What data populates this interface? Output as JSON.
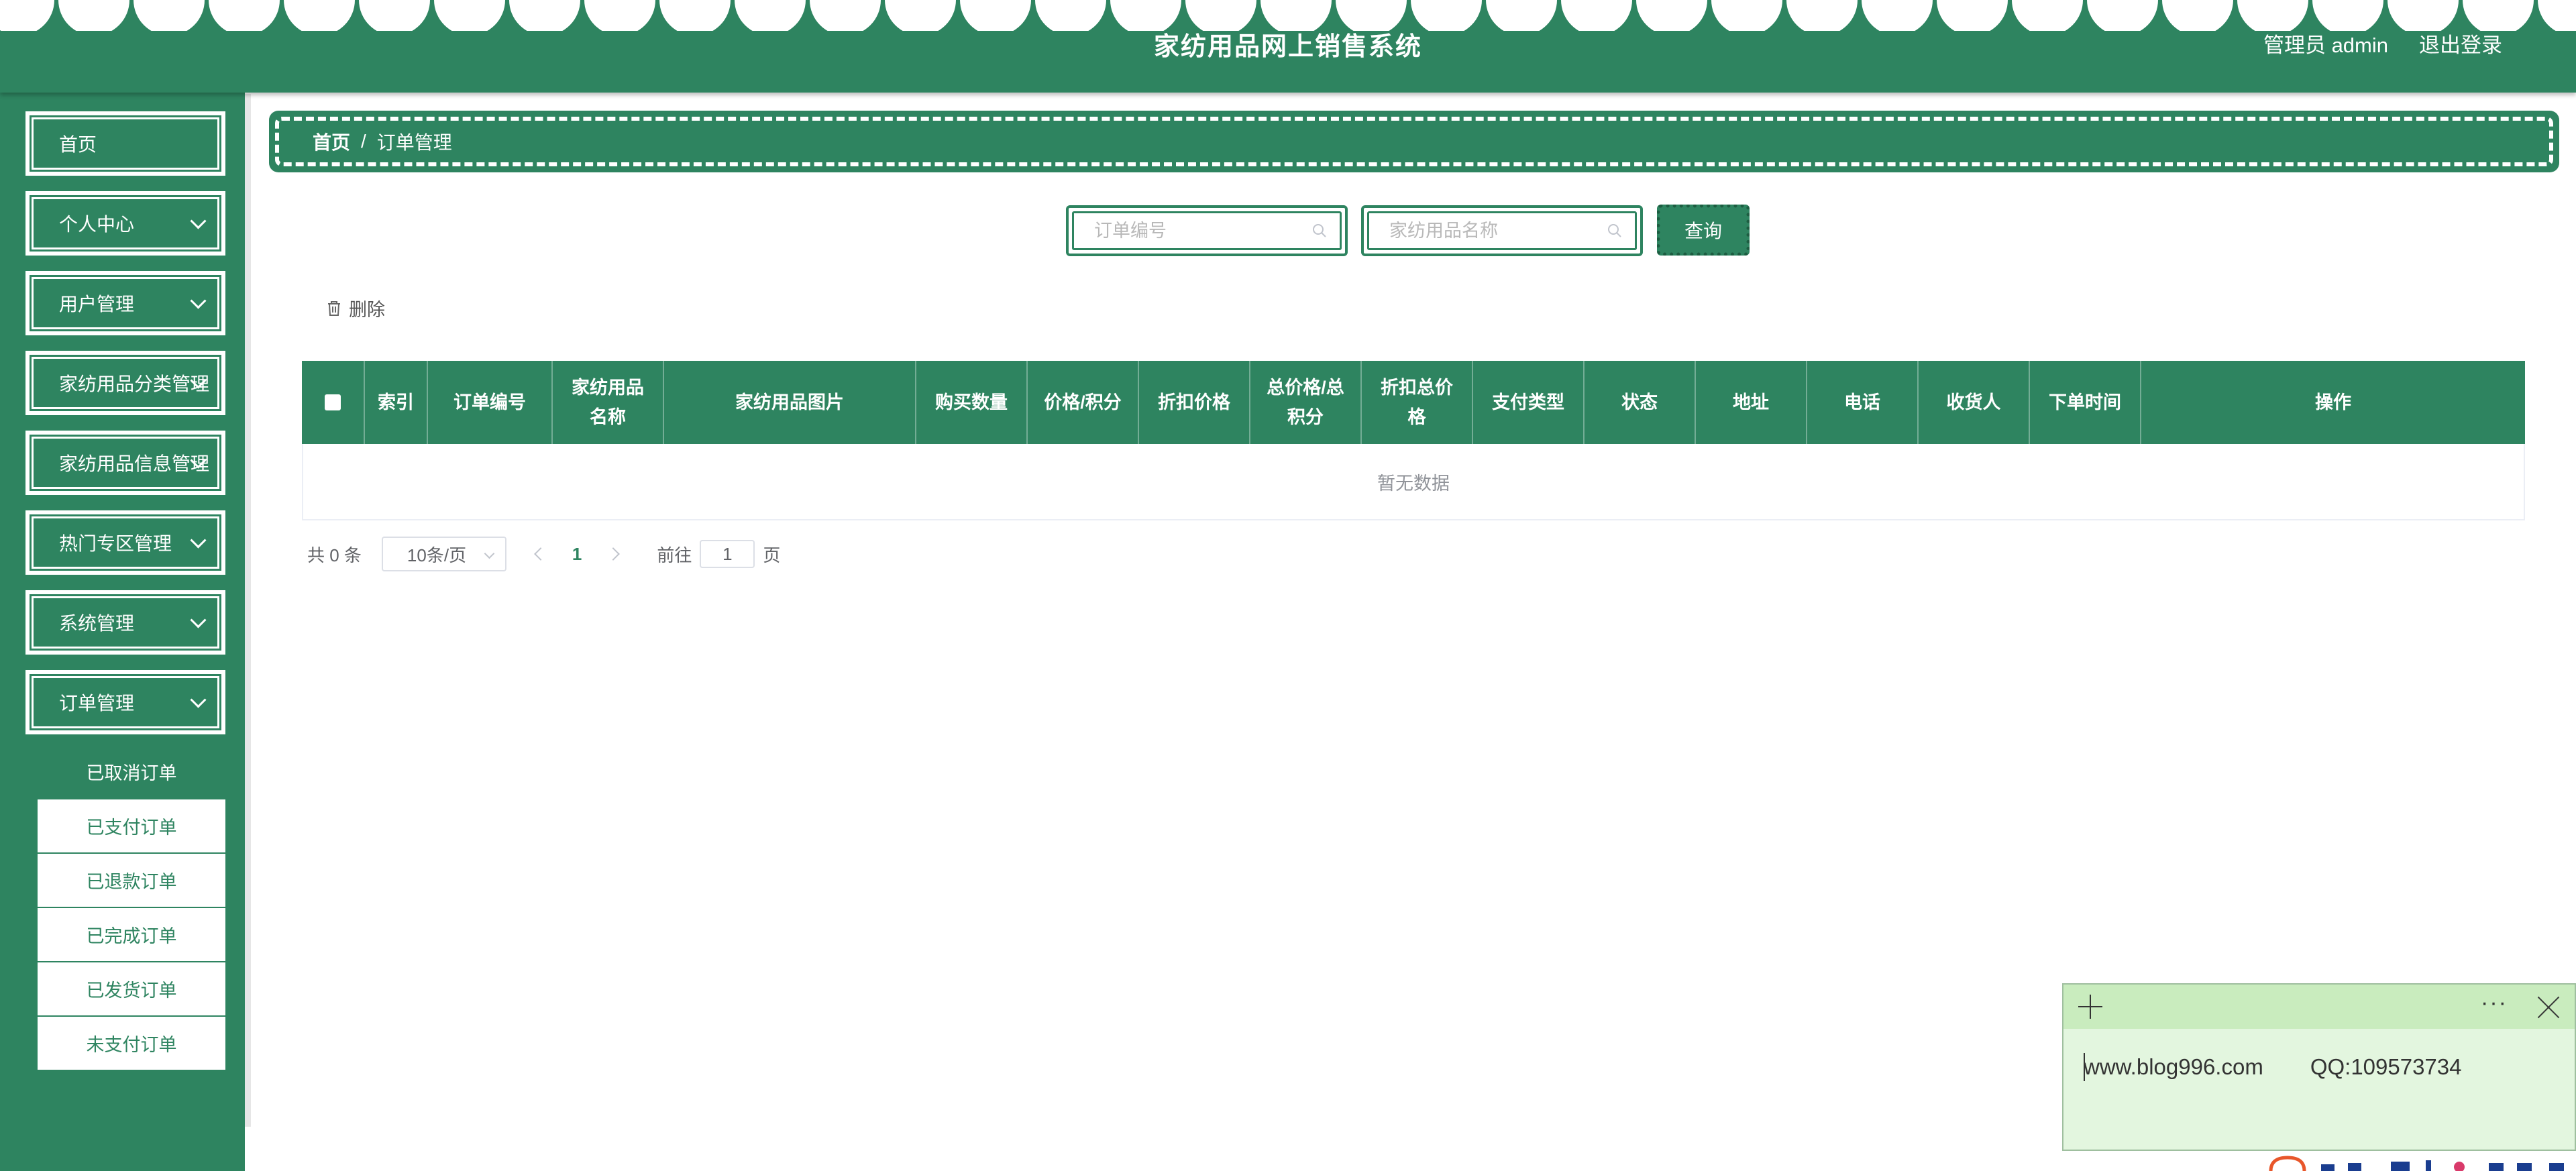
{
  "header": {
    "title": "家纺用品网上销售系统",
    "user_label": "管理员 admin",
    "logout_label": "退出登录"
  },
  "sidebar": {
    "items": [
      {
        "label": "首页",
        "has_children": false
      },
      {
        "label": "个人中心",
        "has_children": true
      },
      {
        "label": "用户管理",
        "has_children": true
      },
      {
        "label": "家纺用品分类管理",
        "has_children": true
      },
      {
        "label": "家纺用品信息管理",
        "has_children": true
      },
      {
        "label": "热门专区管理",
        "has_children": true
      },
      {
        "label": "系统管理",
        "has_children": true
      },
      {
        "label": "订单管理",
        "has_children": true,
        "expanded": true
      }
    ],
    "order_submenu": [
      {
        "label": "已取消订单",
        "active": true
      },
      {
        "label": "已支付订单",
        "active": false
      },
      {
        "label": "已退款订单",
        "active": false
      },
      {
        "label": "已完成订单",
        "active": false
      },
      {
        "label": "已发货订单",
        "active": false
      },
      {
        "label": "未支付订单",
        "active": false
      }
    ]
  },
  "breadcrumb": {
    "home": "首页",
    "separator": "/",
    "current": "订单管理"
  },
  "search": {
    "order_no_placeholder": "订单编号",
    "order_no_value": "",
    "product_name_placeholder": "家纺用品名称",
    "product_name_value": "",
    "query_label": "查询"
  },
  "toolbar": {
    "delete_label": "删除"
  },
  "table": {
    "columns": [
      "索引",
      "订单编号",
      "家纺用品名称",
      "家纺用品图片",
      "购买数量",
      "价格/积分",
      "折扣价格",
      "总价格/总积分",
      "折扣总价格",
      "支付类型",
      "状态",
      "地址",
      "电话",
      "收货人",
      "下单时间",
      "操作"
    ],
    "column_display": [
      "索引",
      "订单编号",
      "家纺用品\n名称",
      "家纺用品图片",
      "购买数量",
      "价格/积分",
      "折扣价格",
      "总价格/总\n积分",
      "折扣总价\n格",
      "支付类型",
      "状态",
      "地址",
      "电话",
      "收货人",
      "下单时间",
      "操作"
    ],
    "rows": [],
    "empty_text": "暂无数据"
  },
  "pagination": {
    "total_label": "共 0 条",
    "page_size_label": "10条/页",
    "current_page": "1",
    "goto_label": "前往",
    "goto_value": "1",
    "goto_suffix": "页"
  },
  "sticky_note": {
    "website": "www.blog996.com",
    "qq": "QQ:109573734"
  },
  "colors": {
    "primary": "#2e8460",
    "header_text": "#ffffff",
    "note_bg": "#e3f6df",
    "note_bar": "#c9ecbe"
  }
}
